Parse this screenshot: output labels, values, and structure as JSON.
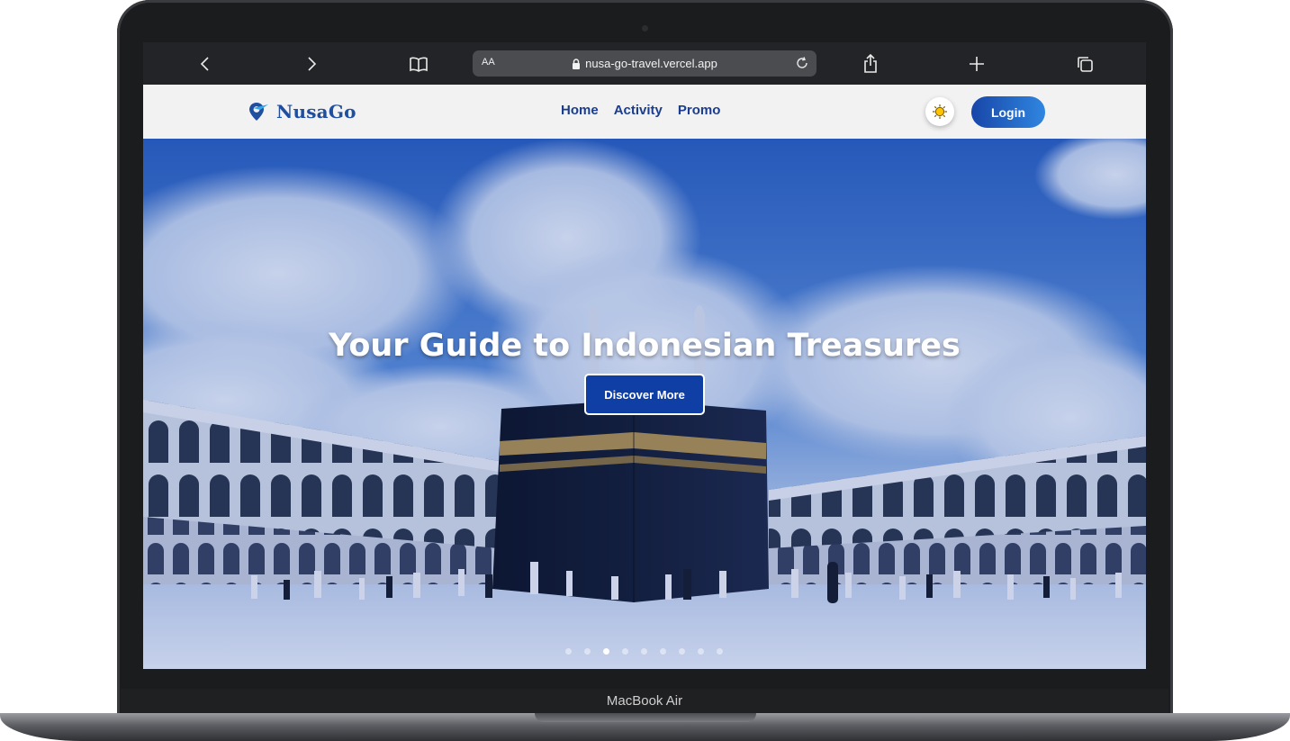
{
  "device": {
    "model_label": "MacBook Air"
  },
  "browser": {
    "aa_label": "AA",
    "url": "nusa-go-travel.vercel.app",
    "icons": [
      "chevron-left-icon",
      "chevron-right-icon",
      "book-icon",
      "lock-icon",
      "reload-icon",
      "share-icon",
      "plus-icon",
      "tabs-icon"
    ]
  },
  "site": {
    "logo_text": "NusaGo",
    "nav": {
      "home": "Home",
      "activity": "Activity",
      "promo": "Promo"
    },
    "theme_toggle_icon": "sun-icon",
    "login_label": "Login",
    "hero": {
      "title": "Your Guide to Indonesian Treasures",
      "cta_label": "Discover More",
      "slide_count": 9,
      "active_slide": 3
    },
    "colors": {
      "brand": "#1f4fa0",
      "nav_text": "#1b3d8f",
      "cta_bg": "#0f3fa5"
    }
  }
}
